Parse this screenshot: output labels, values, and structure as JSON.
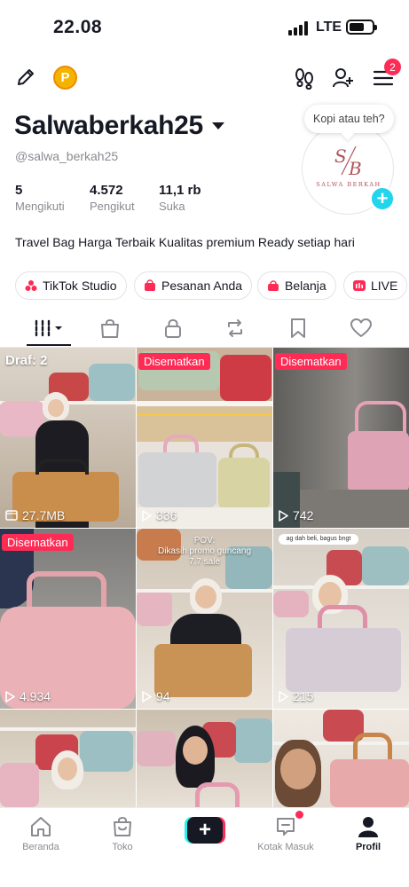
{
  "status_bar": {
    "time": "22.08",
    "network": "LTE"
  },
  "header": {
    "coin_letter": "P",
    "menu_badge": "2"
  },
  "profile": {
    "username": "Salwaberkah25",
    "handle": "@salwa_berkah25",
    "bubble_text": "Kopi atau teh?",
    "avatar_logo_text": "SALWA BERKAH",
    "avatar_plus": "+",
    "stats": [
      {
        "value": "5",
        "label": "Mengikuti"
      },
      {
        "value": "4.572",
        "label": "Pengikut"
      },
      {
        "value": "11,1 rb",
        "label": "Suka"
      }
    ],
    "bio": "Travel Bag Harga Terbaik Kualitas premium Ready setiap hari"
  },
  "quick_links": [
    {
      "label": "TikTok Studio",
      "icon": "studio-icon"
    },
    {
      "label": "Pesanan Anda",
      "icon": "orders-icon"
    },
    {
      "label": "Belanja",
      "icon": "bag-icon"
    },
    {
      "label": "LIVE",
      "icon": "live-icon"
    }
  ],
  "tabs": [
    {
      "name": "videos",
      "icon": "grid-icon",
      "active": true
    },
    {
      "name": "shop",
      "icon": "shopping-bag-icon"
    },
    {
      "name": "private",
      "icon": "lock-icon"
    },
    {
      "name": "reposts",
      "icon": "repost-icon"
    },
    {
      "name": "favorites",
      "icon": "bookmark-icon"
    },
    {
      "name": "liked",
      "icon": "heart-icon"
    }
  ],
  "videos": [
    {
      "badge": "Draf: 2",
      "badge_type": "draft",
      "stat": "27.7MB",
      "stat_type": "size"
    },
    {
      "badge": "Disematkan",
      "badge_type": "pinned",
      "stat": "336",
      "stat_type": "views"
    },
    {
      "badge": "Disematkan",
      "badge_type": "pinned",
      "stat": "742",
      "stat_type": "views"
    },
    {
      "badge": "Disematkan",
      "badge_type": "pinned",
      "stat": "4.934",
      "stat_type": "views"
    },
    {
      "badge": "",
      "overlay": "POV:\nDikasih promo guncang\n7.7 sale",
      "stat": "94",
      "stat_type": "views"
    },
    {
      "badge": "",
      "overlay": "ag dah beli, bagus bngt",
      "stat": "215",
      "stat_type": "views"
    },
    {
      "badge": "",
      "stat": "",
      "stat_type": "views"
    },
    {
      "badge": "",
      "stat": "",
      "stat_type": "views"
    },
    {
      "badge": "",
      "stat": "",
      "stat_type": "views"
    }
  ],
  "bottom_nav": [
    {
      "label": "Beranda",
      "icon": "home-icon"
    },
    {
      "label": "Toko",
      "icon": "shop-icon"
    },
    {
      "label": "",
      "icon": "create-icon"
    },
    {
      "label": "Kotak Masuk",
      "icon": "inbox-icon"
    },
    {
      "label": "Profil",
      "icon": "profile-icon",
      "active": true
    }
  ],
  "colors": {
    "accent": "#fe2c55",
    "cyan": "#20d5ec",
    "text": "#161823",
    "muted": "#8a8b91"
  }
}
